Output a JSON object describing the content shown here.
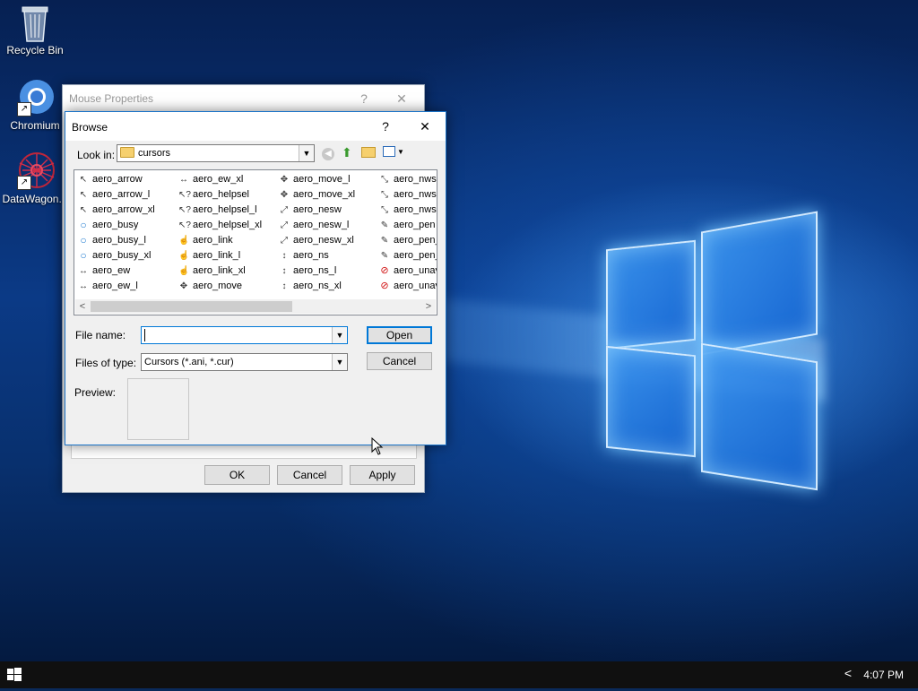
{
  "desktop": {
    "icons": [
      {
        "label": "Recycle Bin"
      },
      {
        "label": "Chromium"
      },
      {
        "label": "DataWagon..."
      }
    ]
  },
  "mouse_properties": {
    "title": "Mouse Properties",
    "help": "?",
    "close": "✕",
    "ok_label": "OK",
    "cancel_label": "Cancel",
    "apply_label": "Apply"
  },
  "browse": {
    "title": "Browse",
    "help": "?",
    "close": "✕",
    "look_in_label": "Look in:",
    "look_in_value": "cursors",
    "file_name_label": "File name:",
    "file_name_value": "",
    "files_of_type_label": "Files of type:",
    "files_of_type_value": "Cursors (*.ani, *.cur)",
    "preview_label": "Preview:",
    "open_label": "Open",
    "cancel_label": "Cancel",
    "files": [
      [
        {
          "name": "aero_arrow",
          "icon": "arrow"
        },
        {
          "name": "aero_arrow_l",
          "icon": "arrow"
        },
        {
          "name": "aero_arrow_xl",
          "icon": "arrow"
        },
        {
          "name": "aero_busy",
          "icon": "busy"
        },
        {
          "name": "aero_busy_l",
          "icon": "busy"
        },
        {
          "name": "aero_busy_xl",
          "icon": "busy"
        },
        {
          "name": "aero_ew",
          "icon": "ew"
        },
        {
          "name": "aero_ew_l",
          "icon": "ew"
        }
      ],
      [
        {
          "name": "aero_ew_xl",
          "icon": "ew"
        },
        {
          "name": "aero_helpsel",
          "icon": "helpsel"
        },
        {
          "name": "aero_helpsel_l",
          "icon": "helpsel"
        },
        {
          "name": "aero_helpsel_xl",
          "icon": "helpsel"
        },
        {
          "name": "aero_link",
          "icon": "hand"
        },
        {
          "name": "aero_link_l",
          "icon": "hand"
        },
        {
          "name": "aero_link_xl",
          "icon": "hand"
        },
        {
          "name": "aero_move",
          "icon": "move"
        }
      ],
      [
        {
          "name": "aero_move_l",
          "icon": "move"
        },
        {
          "name": "aero_move_xl",
          "icon": "move"
        },
        {
          "name": "aero_nesw",
          "icon": "nesw"
        },
        {
          "name": "aero_nesw_l",
          "icon": "nesw"
        },
        {
          "name": "aero_nesw_xl",
          "icon": "nesw"
        },
        {
          "name": "aero_ns",
          "icon": "ns"
        },
        {
          "name": "aero_ns_l",
          "icon": "ns"
        },
        {
          "name": "aero_ns_xl",
          "icon": "ns"
        }
      ],
      [
        {
          "name": "aero_nws",
          "icon": "nwse"
        },
        {
          "name": "aero_nws",
          "icon": "nwse"
        },
        {
          "name": "aero_nws",
          "icon": "nwse"
        },
        {
          "name": "aero_pen",
          "icon": "pen"
        },
        {
          "name": "aero_pen_",
          "icon": "pen"
        },
        {
          "name": "aero_pen_",
          "icon": "pen"
        },
        {
          "name": "aero_unav",
          "icon": "unavailable"
        },
        {
          "name": "aero_unav",
          "icon": "unavailable"
        }
      ]
    ]
  },
  "taskbar": {
    "time": "4:07 PM",
    "chevron": "<"
  },
  "colors": {
    "accent": "#0078d7",
    "desktop_blue": "#0b3a86"
  }
}
